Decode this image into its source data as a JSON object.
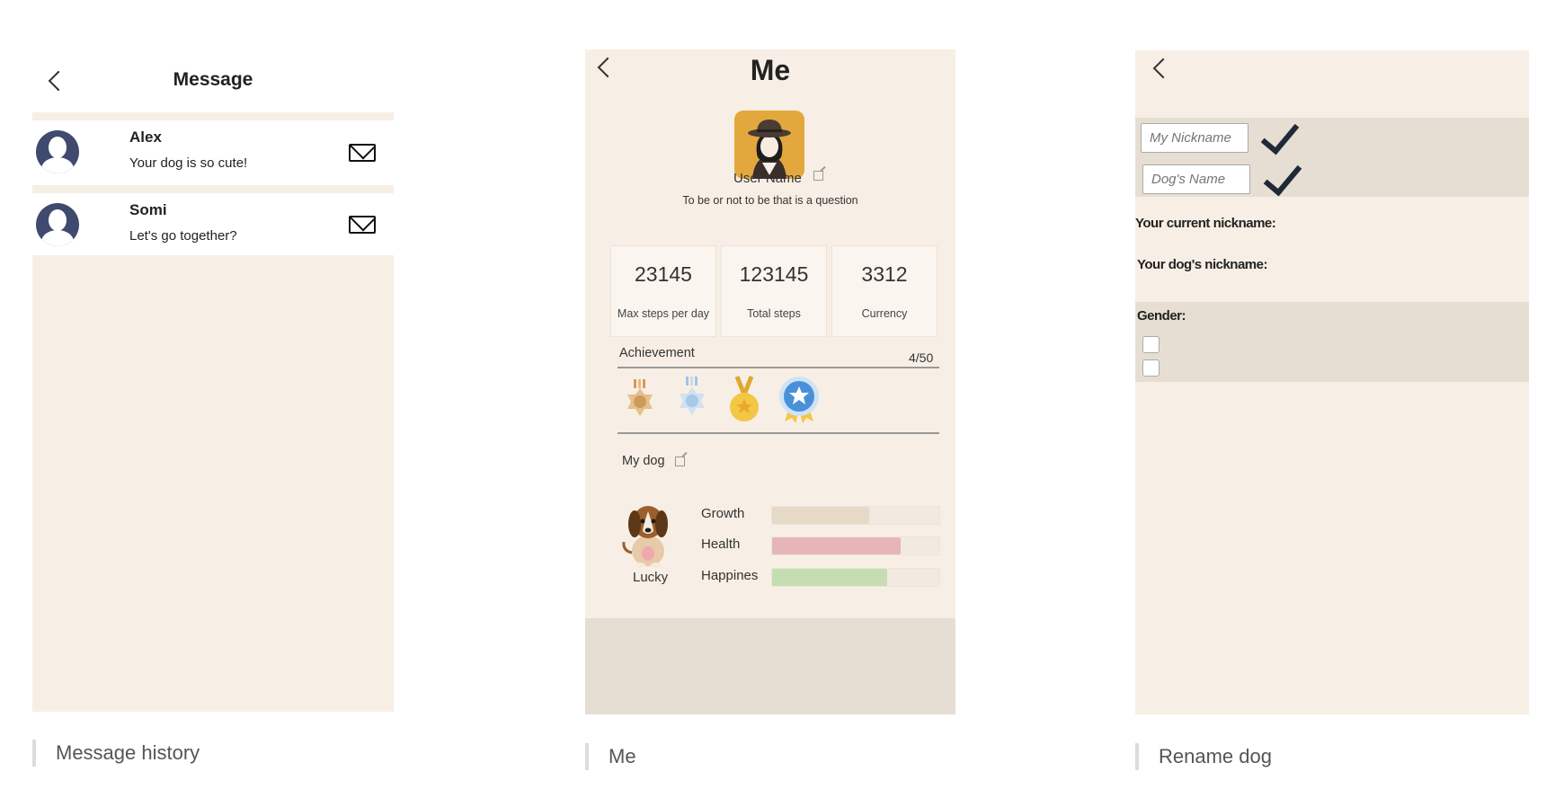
{
  "message_screen": {
    "title": "Message",
    "messages": [
      {
        "name": "Alex",
        "text": "Your dog is so cute!"
      },
      {
        "name": "Somi",
        "text": "Let's go together?"
      }
    ],
    "caption": "Message history"
  },
  "me_screen": {
    "title": "Me",
    "user_name": "User Name",
    "bio": "To be or not to be that is a question",
    "stats": [
      {
        "value": "23145",
        "label": "Max steps per day"
      },
      {
        "value": "123145",
        "label": "Total steps"
      },
      {
        "value": "3312",
        "label": "Currency"
      }
    ],
    "achievement": {
      "label": "Achievement",
      "count": "4/50"
    },
    "my_dog_label": "My dog",
    "dog_name": "Lucky",
    "bars": [
      {
        "label": "Growth",
        "percent": 58,
        "color": "#e6d9c6"
      },
      {
        "label": "Health",
        "percent": 77,
        "color": "#e5b5b8"
      },
      {
        "label": "Happines",
        "percent": 69,
        "color": "#c6ddb1"
      }
    ],
    "caption": "Me"
  },
  "rename_screen": {
    "nickname_placeholder": "My Nickname",
    "dogname_placeholder": "Dog's Name",
    "current_nickname_label": "Your current nickname:",
    "dog_nickname_label": "Your dog's nickname:",
    "gender_label": "Gender:",
    "caption": "Rename dog"
  },
  "colors": {
    "screen_bg": "#f7efe5",
    "band_bg": "#e6ded2"
  }
}
